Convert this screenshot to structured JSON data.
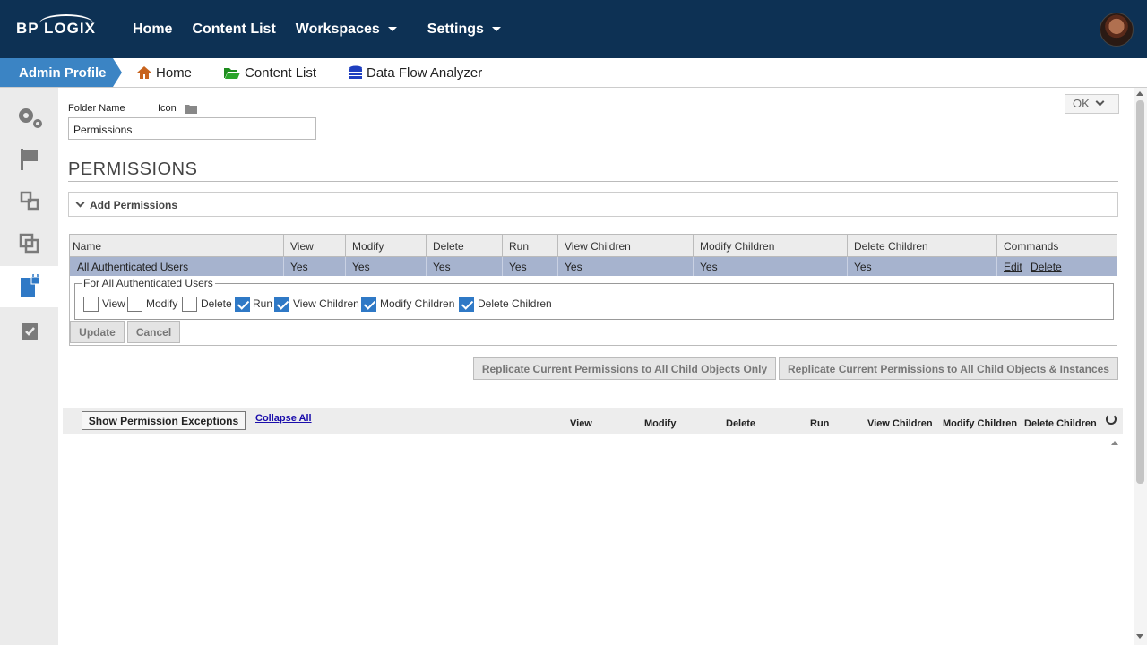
{
  "brand": {
    "logo_text": "BP LOGIX"
  },
  "topnav": {
    "home": "Home",
    "content_list": "Content List",
    "workspaces": "Workspaces",
    "settings": "Settings"
  },
  "subnav": {
    "crumb": "Admin Profile",
    "home": "Home",
    "content_list": "Content List",
    "data_flow": "Data Flow Analyzer"
  },
  "form": {
    "folder_name_label": "Folder Name",
    "icon_label": "Icon",
    "folder_name_value": "Permissions",
    "ok_label": "OK"
  },
  "permissions": {
    "heading": "PERMISSIONS",
    "add_label": "Add Permissions",
    "columns": [
      "Name",
      "View",
      "Modify",
      "Delete",
      "Run",
      "View Children",
      "Modify Children",
      "Delete Children",
      "Commands"
    ],
    "row": {
      "name": "All Authenticated Users",
      "view": "Yes",
      "modify": "Yes",
      "delete": "Yes",
      "run": "Yes",
      "view_children": "Yes",
      "modify_children": "Yes",
      "delete_children": "Yes",
      "edit": "Edit",
      "delete_cmd": "Delete"
    },
    "edit_legend": "For All Authenticated Users",
    "checks": [
      {
        "label": "View",
        "checked": false
      },
      {
        "label": "Modify",
        "checked": false
      },
      {
        "label": "Delete",
        "checked": false
      },
      {
        "label": "Run",
        "checked": true
      },
      {
        "label": "View Children",
        "checked": true
      },
      {
        "label": "Modify Children",
        "checked": true
      },
      {
        "label": "Delete Children",
        "checked": true
      }
    ],
    "update_label": "Update",
    "cancel_label": "Cancel",
    "replicate_only": "Replicate Current Permissions to All Child Objects Only",
    "replicate_instances": "Replicate Current Permissions to All Child Objects & Instances"
  },
  "exceptions": {
    "show_button": "Show Permission Exceptions",
    "collapse_all": "Collapse All",
    "columns": [
      "View",
      "Modify",
      "Delete",
      "Run",
      "View Children",
      "Modify Children",
      "Delete Children"
    ]
  },
  "colors": {
    "topbar": "#0d3154",
    "crumb": "#3b84c4",
    "row_selected": "#a6b3ce",
    "checkbox_on": "#2f79c6"
  }
}
